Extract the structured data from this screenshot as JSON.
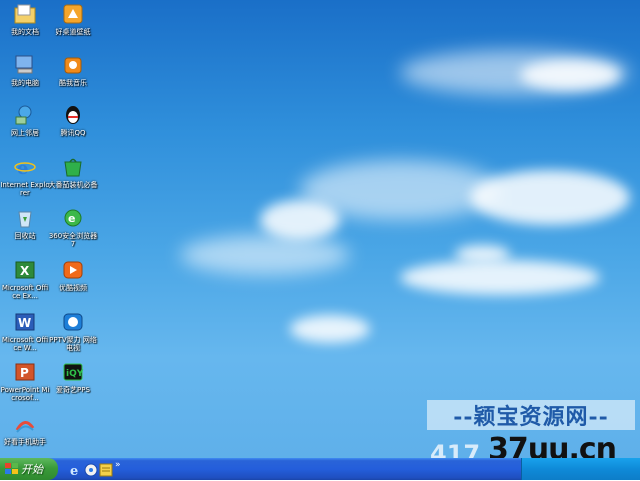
{
  "desktop": {
    "icons": [
      {
        "label": "我的文档",
        "icon": "my-documents-icon"
      },
      {
        "label": "好桌道壁纸",
        "icon": "wallpaper-app-icon"
      },
      {
        "label": "我的电脑",
        "icon": "my-computer-icon"
      },
      {
        "label": "酷我音乐",
        "icon": "kuwo-music-icon"
      },
      {
        "label": "网上邻居",
        "icon": "network-places-icon"
      },
      {
        "label": "腾讯QQ",
        "icon": "qq-icon"
      },
      {
        "label": "Internet Explorer",
        "icon": "internet-explorer-icon"
      },
      {
        "label": "大番茄装机必备",
        "icon": "software-store-icon"
      },
      {
        "label": "回收站",
        "icon": "recycle-bin-icon"
      },
      {
        "label": "360安全浏览器7",
        "icon": "360-browser-icon"
      },
      {
        "label": "Microsoft Office Ex...",
        "icon": "excel-icon"
      },
      {
        "label": "优酷视频",
        "icon": "youku-icon"
      },
      {
        "label": "Microsoft Office W...",
        "icon": "word-icon"
      },
      {
        "label": "PPTV聚力 网络电视",
        "icon": "pptv-icon"
      },
      {
        "label": "PowerPoint Microsof...",
        "icon": "powerpoint-icon"
      },
      {
        "label": "爱奇艺PPS",
        "icon": "iqiyi-icon"
      },
      {
        "label": "好看手机助手",
        "icon": "phone-assistant-icon"
      }
    ]
  },
  "taskbar": {
    "start_label": "开始",
    "quick_launch": [
      "ie-quicklaunch-icon",
      "media-quicklaunch-icon",
      "notes-quicklaunch-icon"
    ],
    "chevron": "»"
  },
  "watermark": {
    "brand": "--颖宝资源网--",
    "number": "417",
    "url": "37uu.cn"
  },
  "colors": {
    "taskbar": "#245edb",
    "start": "#3a9b3a",
    "tray": "#0f8ad8"
  }
}
